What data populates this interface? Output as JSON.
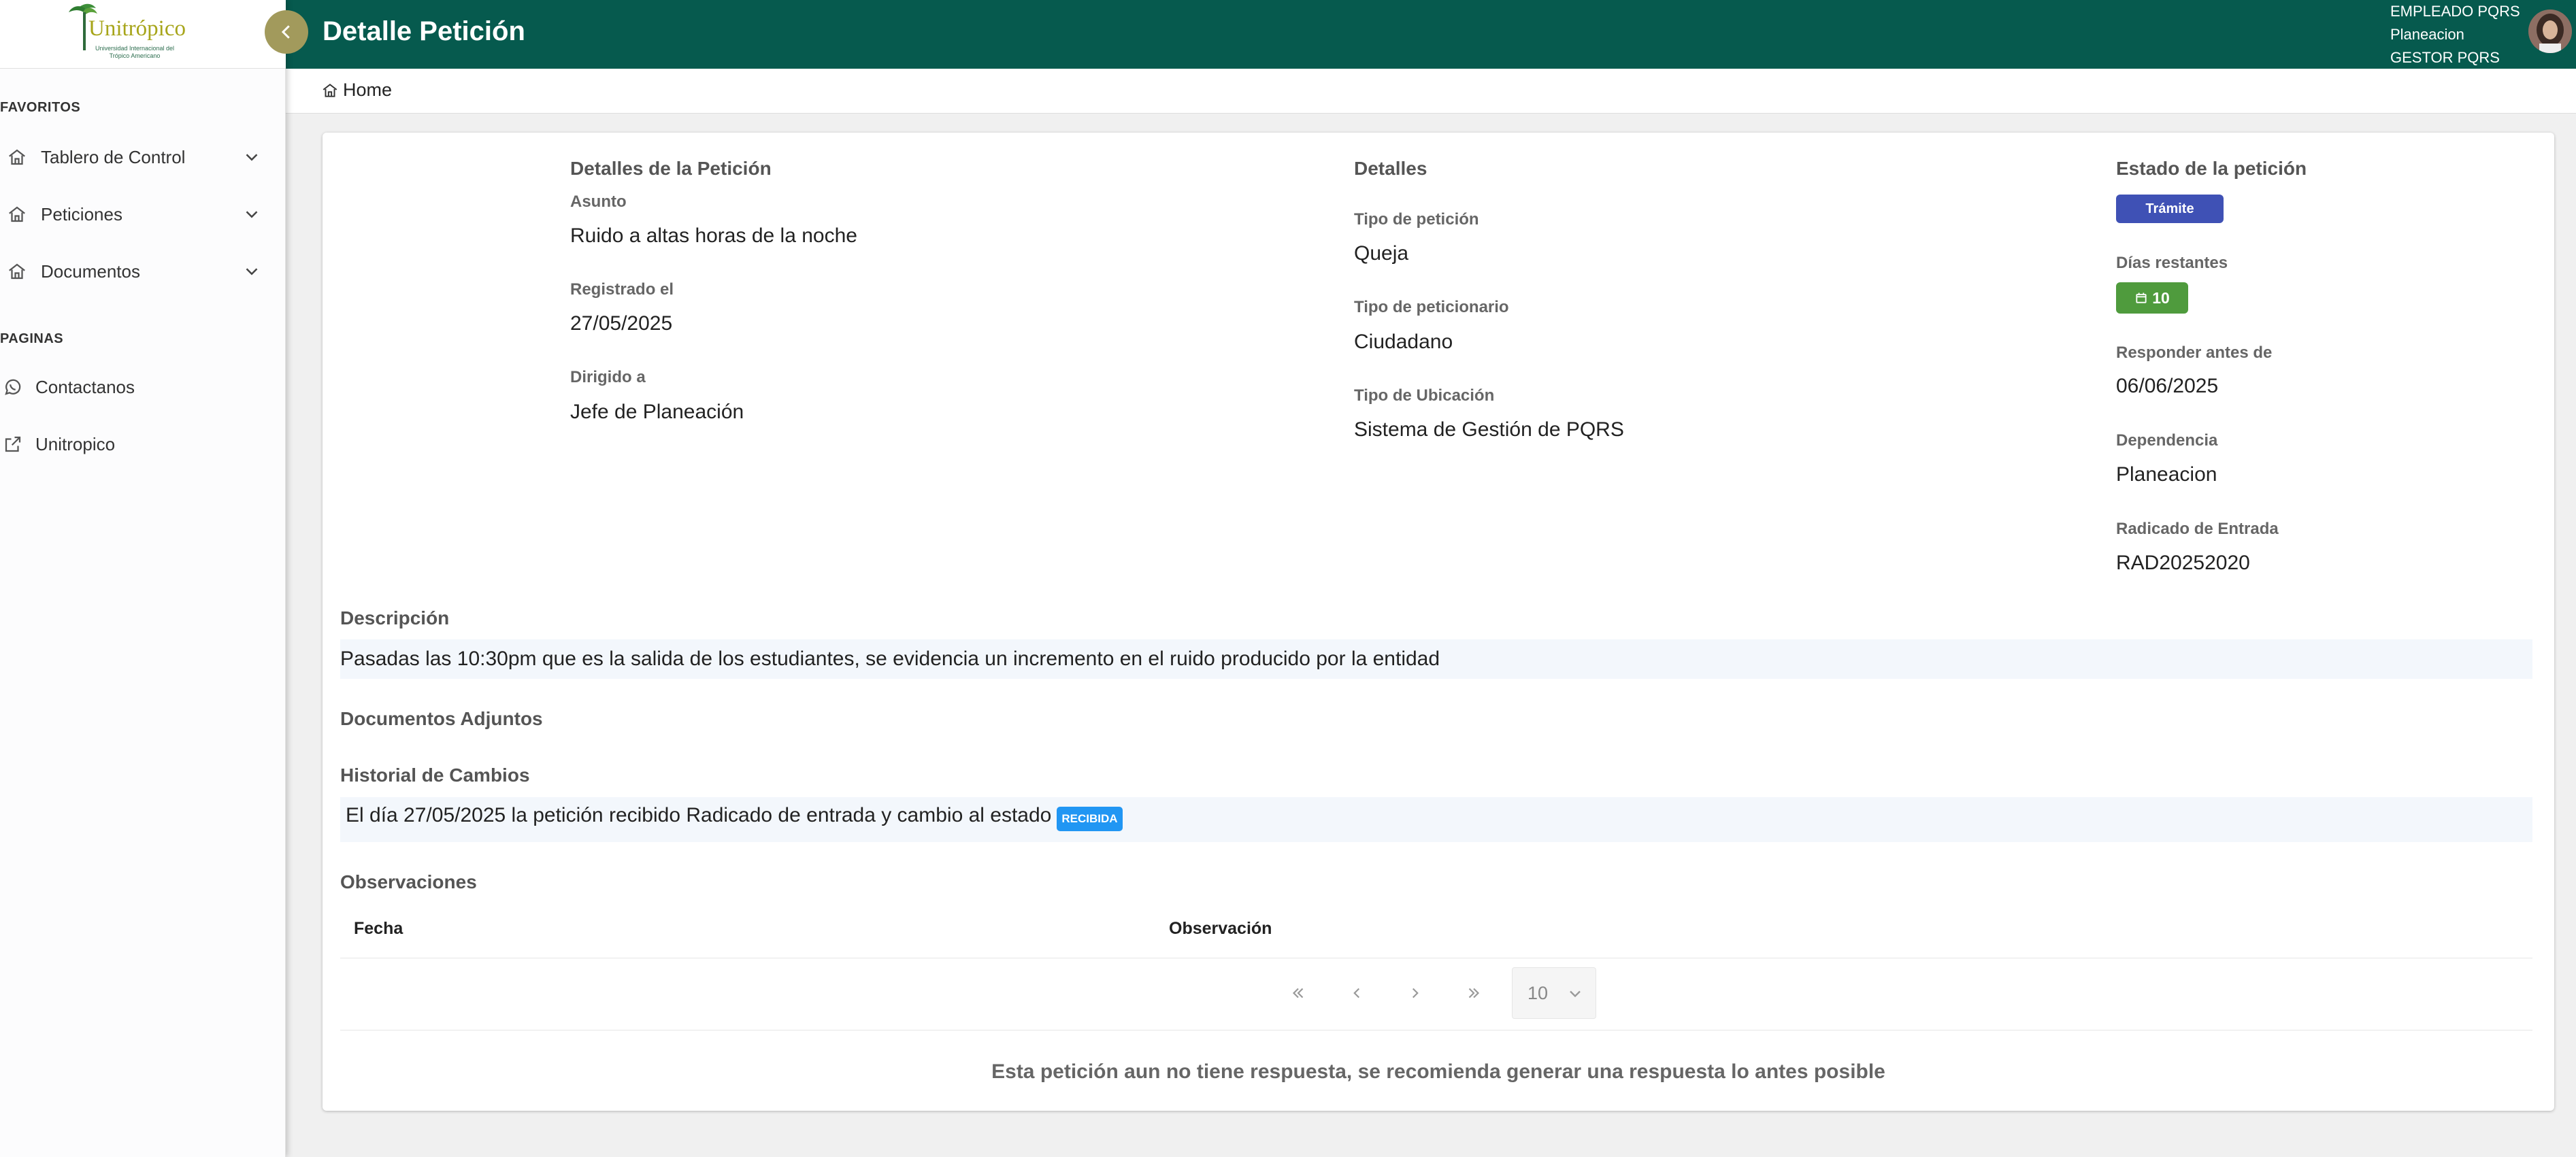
{
  "sidebar": {
    "logo_text": "Unitrópico",
    "logo_sub": "Universidad Internacional del Trópico Americano",
    "sections": {
      "favoritos": "FAVORITOS",
      "paginas": "PAGINAS"
    },
    "favorites": [
      {
        "label": "Tablero de Control",
        "icon": "home-icon"
      },
      {
        "label": "Peticiones",
        "icon": "home-icon"
      },
      {
        "label": "Documentos",
        "icon": "home-icon"
      }
    ],
    "pages": [
      {
        "label": "Contactanos",
        "icon": "whatsapp-icon"
      },
      {
        "label": "Unitropico",
        "icon": "external-link-icon"
      }
    ]
  },
  "header": {
    "title": "Detalle Petición",
    "user_lines": [
      "EMPLEADO PQRS",
      "Planeacion",
      "GESTOR PQRS"
    ]
  },
  "breadcrumb": {
    "home": "Home"
  },
  "details_left": {
    "title": "Detalles de la Petición",
    "fields": [
      {
        "label": "Asunto",
        "value": "Ruido a altas horas de la noche"
      },
      {
        "label": "Registrado el",
        "value": "27/05/2025"
      },
      {
        "label": "Dirigido a",
        "value": "Jefe de Planeación"
      }
    ]
  },
  "details_mid": {
    "title": "Detalles",
    "fields": [
      {
        "label": "Tipo de petición",
        "value": "Queja"
      },
      {
        "label": "Tipo de peticionario",
        "value": "Ciudadano"
      },
      {
        "label": "Tipo de Ubicación",
        "value": "Sistema de Gestión de PQRS"
      }
    ]
  },
  "status": {
    "title": "Estado de la petición",
    "state_chip": "Trámite",
    "days_label": "Días restantes",
    "days_value": "10",
    "respond_label": "Responder antes de",
    "respond_value": "06/06/2025",
    "dep_label": "Dependencia",
    "dep_value": "Planeacion",
    "rad_label": "Radicado de Entrada",
    "rad_value": "RAD20252020"
  },
  "description": {
    "title": "Descripción",
    "text": "Pasadas las 10:30pm que es la salida de los estudiantes, se evidencia un incremento en el ruido producido por la entidad"
  },
  "attachments": {
    "title": "Documentos Adjuntos"
  },
  "history": {
    "title": "Historial de Cambios",
    "entry": "El día 27/05/2025 la petición recibido Radicado de entrada y cambio al estado",
    "chip": "RECIBIDA"
  },
  "observations": {
    "title": "Observaciones",
    "columns": [
      "Fecha",
      "Observación"
    ],
    "page_size": "10"
  },
  "footer_message": "Esta petición aun no tiene respuesta, se recomienda generar una respuesta lo antes posible",
  "colors": {
    "header_bg": "#065a4e",
    "collapse_btn": "#a29a5c",
    "chip_tramite": "#3f51b5",
    "chip_days": "#4f9b3d",
    "chip_recibida": "#2196f3"
  }
}
